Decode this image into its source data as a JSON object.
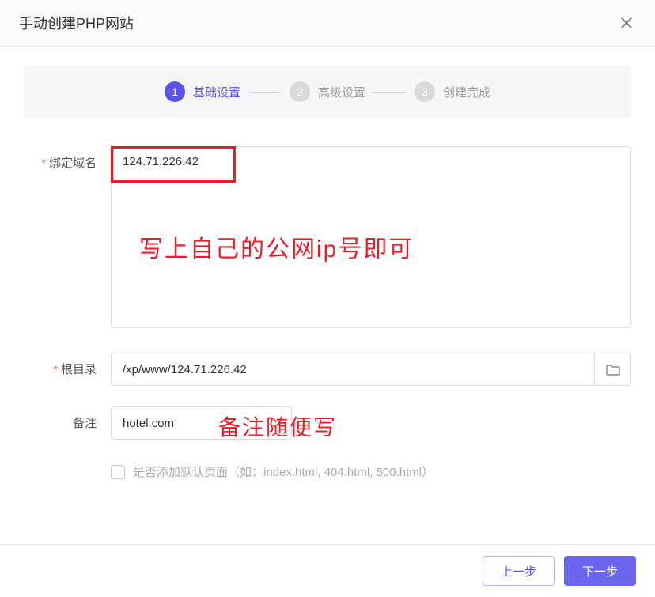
{
  "modal": {
    "title": "手动创建PHP网站"
  },
  "steps": [
    {
      "num": "1",
      "label": "基础设置",
      "state": "active"
    },
    {
      "num": "2",
      "label": "高级设置",
      "state": "inactive"
    },
    {
      "num": "3",
      "label": "创建完成",
      "state": "inactive"
    }
  ],
  "form": {
    "domain_label": "绑定域名",
    "domain_value": "124.71.226.42",
    "root_label": "根目录",
    "root_value": "/xp/www/124.71.226.42",
    "remark_label": "备注",
    "remark_value": "hotel.com",
    "checkbox_label": "是否添加默认页面（如：index.html, 404.html, 500.html）"
  },
  "annotations": {
    "ip_hint": "写上自己的公网ip号即可",
    "remark_hint": "备注随便写"
  },
  "footer": {
    "prev": "上一步",
    "next": "下一步"
  }
}
